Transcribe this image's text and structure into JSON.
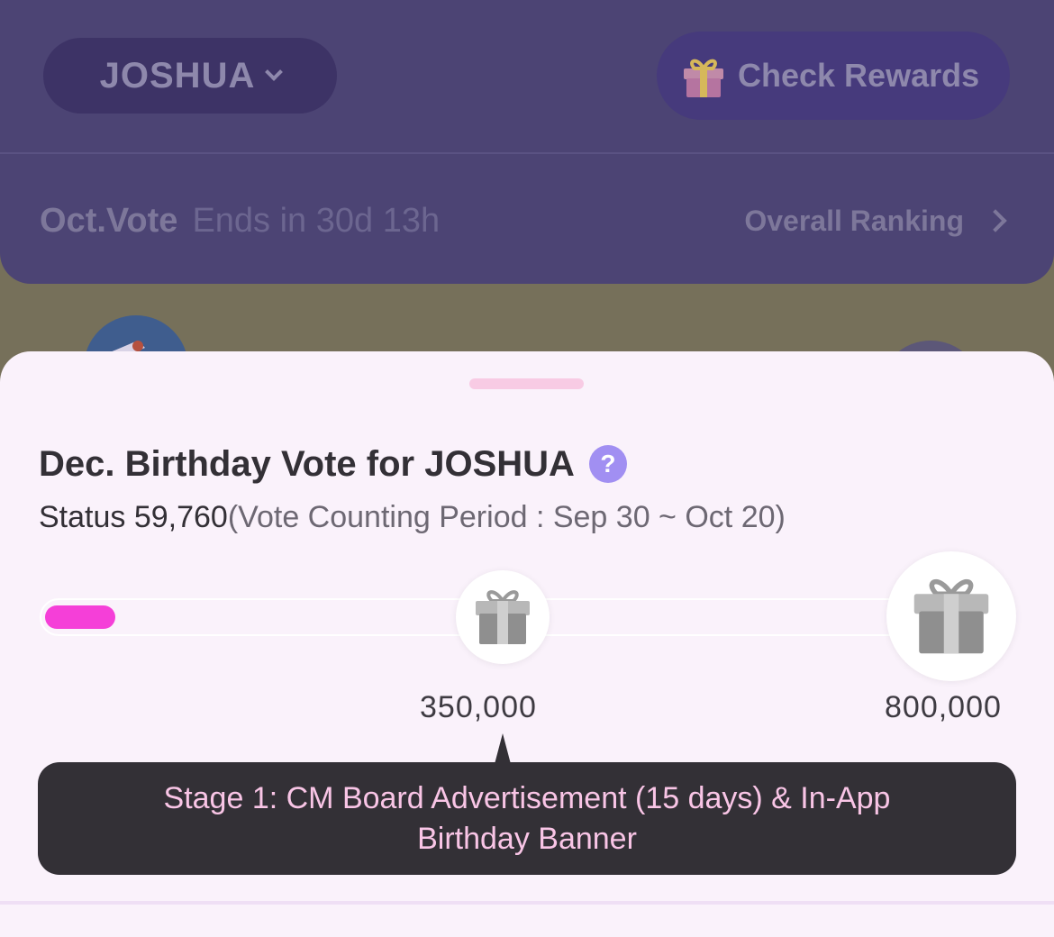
{
  "header": {
    "artist_name": "JOSHUA",
    "check_rewards_label": "Check Rewards"
  },
  "vote_bar": {
    "month": "Oct.Vote",
    "ends_in": "Ends in 30d 13h",
    "overall_ranking_label": "Overall Ranking"
  },
  "sheet": {
    "title": "Dec. Birthday Vote for JOSHUA",
    "help_symbol": "?",
    "status_label": "Status",
    "status_value": "59,760",
    "period_text": "(Vote Counting Period : Sep 30 ~ Oct 20)",
    "progress_fraction": 0.075,
    "milestones": [
      {
        "label": "350,000"
      },
      {
        "label": "800,000"
      }
    ],
    "tooltip_text": "Stage 1: CM Board Advertisement (15 days) & In-App Birthday Banner"
  },
  "colors": {
    "accent_fill": "#f53fd8",
    "help_icon": "#a18ff2",
    "tooltip_bg": "#333036",
    "tooltip_text": "#f9c5e6"
  },
  "icons": [
    "chevron-down-icon",
    "gift-icon",
    "chevron-right-icon",
    "help-icon",
    "gift-milestone-icon"
  ]
}
